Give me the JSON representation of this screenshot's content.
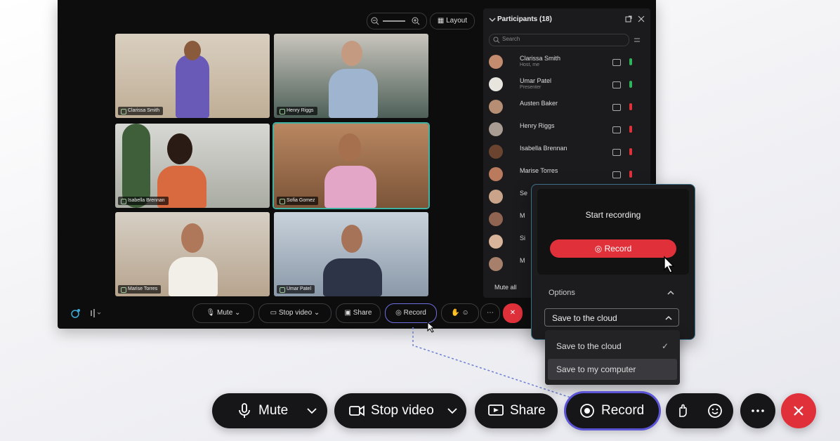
{
  "window": {
    "layout_label": "Layout"
  },
  "tiles": [
    {
      "name": "Clarissa Smith"
    },
    {
      "name": "Henry Riggs"
    },
    {
      "name": "Isabella Brennan"
    },
    {
      "name": "Sofia Gomez"
    },
    {
      "name": "Marise Torres"
    },
    {
      "name": "Umar Patel"
    }
  ],
  "window_controls": {
    "mute": "Mute",
    "stop_video": "Stop video",
    "share": "Share",
    "record": "Record"
  },
  "participants": {
    "title": "Participants (18)",
    "search_placeholder": "Search",
    "mute_all": "Mute all",
    "list": [
      {
        "name": "Clarissa Smith",
        "role": "Host, me"
      },
      {
        "name": "Umar Patel",
        "role": "Presenter"
      },
      {
        "name": "Austen Baker",
        "role": ""
      },
      {
        "name": "Henry Riggs",
        "role": ""
      },
      {
        "name": "Isabella Brennan",
        "role": ""
      },
      {
        "name": "Marise Torres",
        "role": ""
      },
      {
        "name": "Se",
        "role": ""
      },
      {
        "name": "M",
        "role": ""
      },
      {
        "name": "Si",
        "role": ""
      },
      {
        "name": "M",
        "role": ""
      }
    ]
  },
  "record_popover": {
    "title": "Start recording",
    "record_button": "Record",
    "options_label": "Options",
    "selected_option": "Save to the cloud",
    "dropdown_options": [
      {
        "label": "Save to the cloud",
        "selected": true
      },
      {
        "label": "Save to my computer",
        "selected": false
      }
    ]
  },
  "control_bar": {
    "mute": "Mute",
    "stop_video": "Stop video",
    "share": "Share",
    "record": "Record"
  },
  "colors": {
    "record_red": "#e0313b",
    "focus_ring": "#5b55d6",
    "active_speaker": "#3fb2a3"
  }
}
